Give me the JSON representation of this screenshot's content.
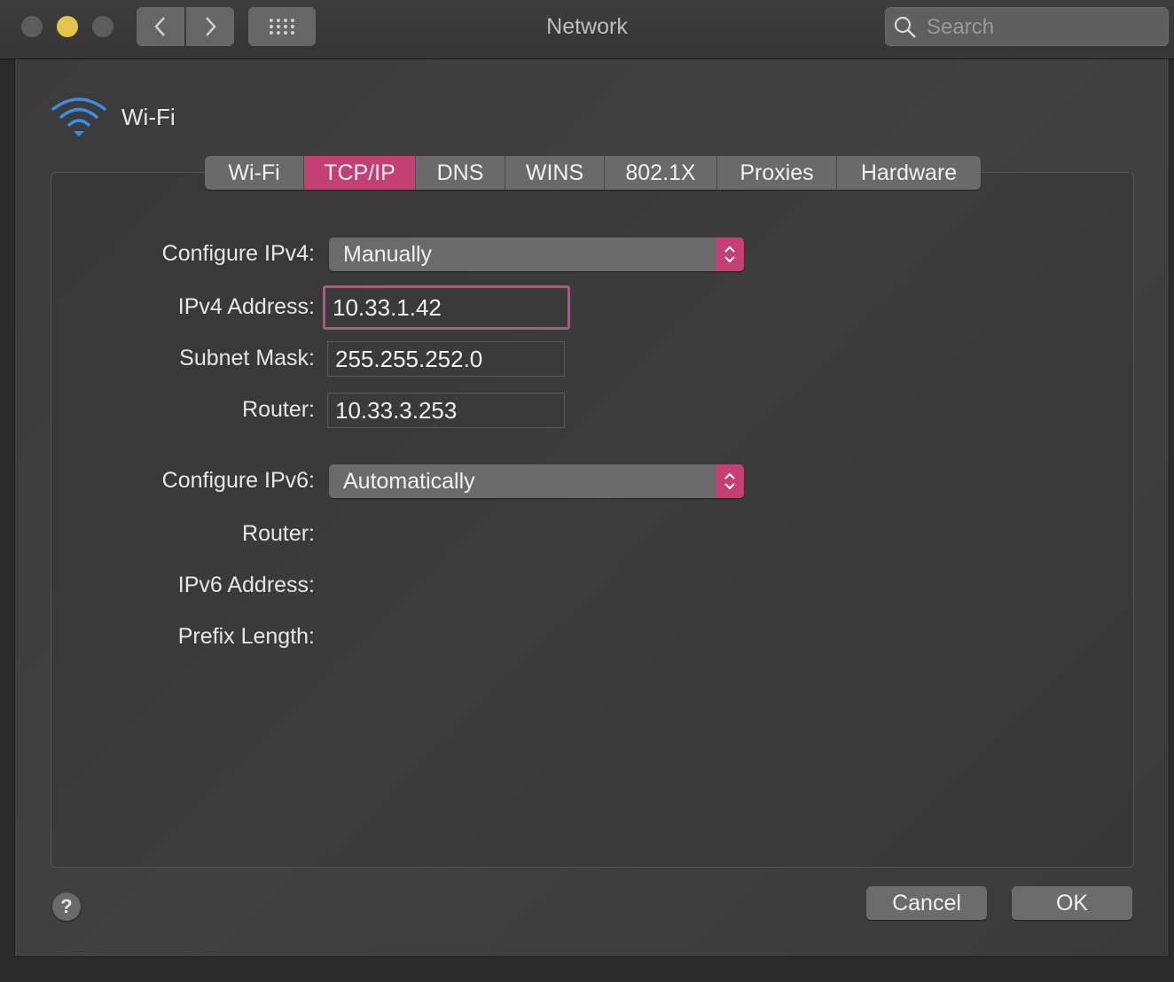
{
  "window": {
    "title": "Network"
  },
  "search": {
    "placeholder": "Search"
  },
  "header": {
    "title": "Wi-Fi"
  },
  "tabs": [
    "Wi-Fi",
    "TCP/IP",
    "DNS",
    "WINS",
    "802.1X",
    "Proxies",
    "Hardware"
  ],
  "active_tab": "TCP/IP",
  "form": {
    "configure_ipv4": {
      "label": "Configure IPv4:",
      "value": "Manually"
    },
    "ipv4_address": {
      "label": "IPv4 Address:",
      "value": "10.33.1.42"
    },
    "subnet_mask": {
      "label": "Subnet Mask:",
      "value": "255.255.252.0"
    },
    "router_v4": {
      "label": "Router:",
      "value": "10.33.3.253"
    },
    "configure_ipv6": {
      "label": "Configure IPv6:",
      "value": "Automatically"
    },
    "router_v6": {
      "label": "Router:"
    },
    "ipv6_address": {
      "label": "IPv6 Address:"
    },
    "prefix_length": {
      "label": "Prefix Length:"
    }
  },
  "buttons": {
    "help": "?",
    "cancel": "Cancel",
    "ok": "OK"
  },
  "colors": {
    "accent": "#c43f74",
    "focus_ring": "#a0607f",
    "wifi_icon": "#3d8de8",
    "minimize_light": "#e4c44a"
  },
  "icons": [
    "back-chevron-icon",
    "forward-chevron-icon",
    "grid-icon",
    "search-icon",
    "wifi-icon",
    "stepper-icon"
  ]
}
